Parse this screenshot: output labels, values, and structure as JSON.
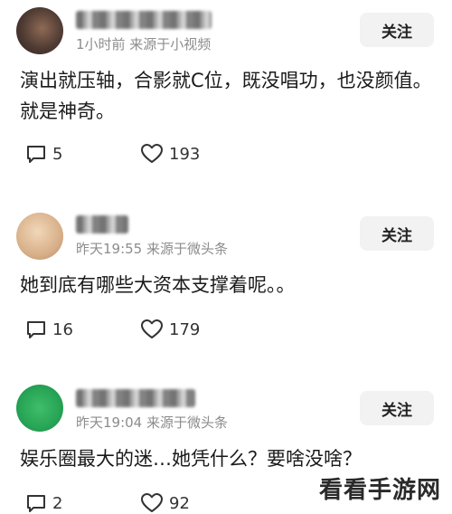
{
  "comments": [
    {
      "meta": "1小时前  来源于小视频",
      "follow_label": "关注",
      "text": "演出就压轴，合影就C位，既没唱功，也没颜值。就是神奇。",
      "reply_count": "5",
      "like_count": "193"
    },
    {
      "meta": "昨天19:55  来源于微头条",
      "follow_label": "关注",
      "text": "她到底有哪些大资本支撑着呢。。",
      "reply_count": "16",
      "like_count": "179"
    },
    {
      "meta": "昨天19:04  来源于微头条",
      "follow_label": "关注",
      "text": "娱乐圈最大的迷…她凭什么？要啥没啥？",
      "reply_count": "2",
      "like_count": "92"
    }
  ],
  "watermark": "看看手游网"
}
